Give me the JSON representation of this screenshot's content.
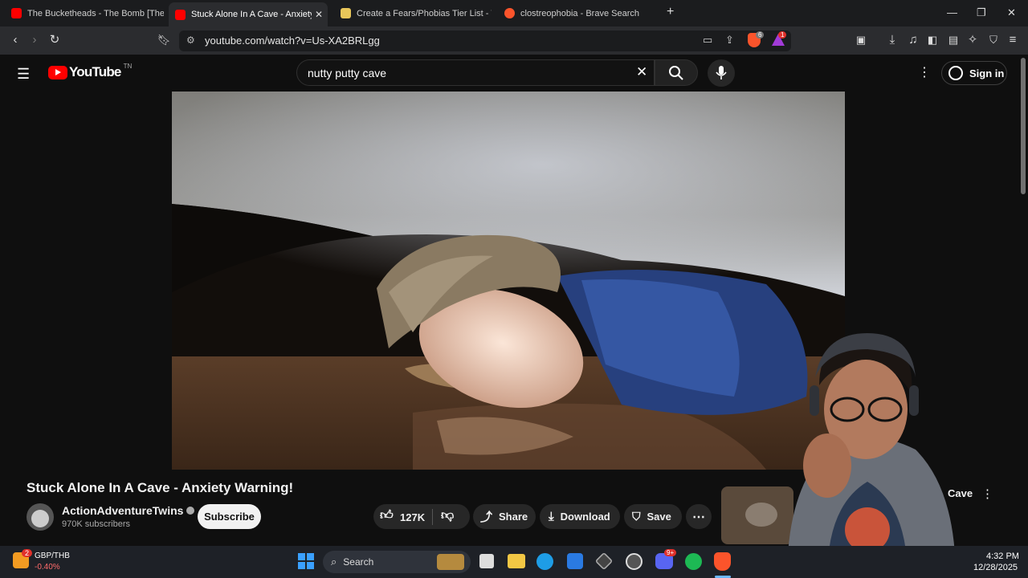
{
  "tabs": [
    {
      "title": "The Bucketheads - The Bomb [These",
      "favicon": "youtube-icon"
    },
    {
      "title": "Stuck Alone In A Cave - Anxiety W",
      "favicon": "youtube-icon",
      "active": true
    },
    {
      "title": "Create a Fears/Phobias Tier List - Tier",
      "favicon": "tiermaker-icon"
    },
    {
      "title": "clostreophobia - Brave Search",
      "favicon": "brave-search-icon"
    }
  ],
  "address_bar": {
    "url": "youtube.com/watch?v=Us-XA2BRLgg"
  },
  "browser_badges": {
    "shield_count": "6",
    "rewards_count": "1"
  },
  "youtube": {
    "logo_text": "YouTube",
    "country_code": "TN",
    "search_query": "nutty putty cave",
    "signin_label": "Sign in"
  },
  "video": {
    "title": "Stuck Alone In A Cave - Anxiety Warning!",
    "channel_name": "ActionAdventureTwins",
    "subscribers": "970K subscribers",
    "subscribe_label": "Subscribe",
    "likes": "127K",
    "share_label": "Share",
    "download_label": "Download",
    "save_label": "Save"
  },
  "sidebar_recommendation": {
    "title_fragment": "Cave"
  },
  "taskbar": {
    "widget_pair": "GBP/THB",
    "widget_change": "-0.40%",
    "widget_badge": "2",
    "search_label": "Search",
    "time": "4:32 PM",
    "date": "12/28/2025",
    "discord_badge": "9+"
  },
  "colors": {
    "youtube_red": "#ff0000",
    "brave_orange": "#fb542b",
    "negative": "#ff6b6b"
  }
}
